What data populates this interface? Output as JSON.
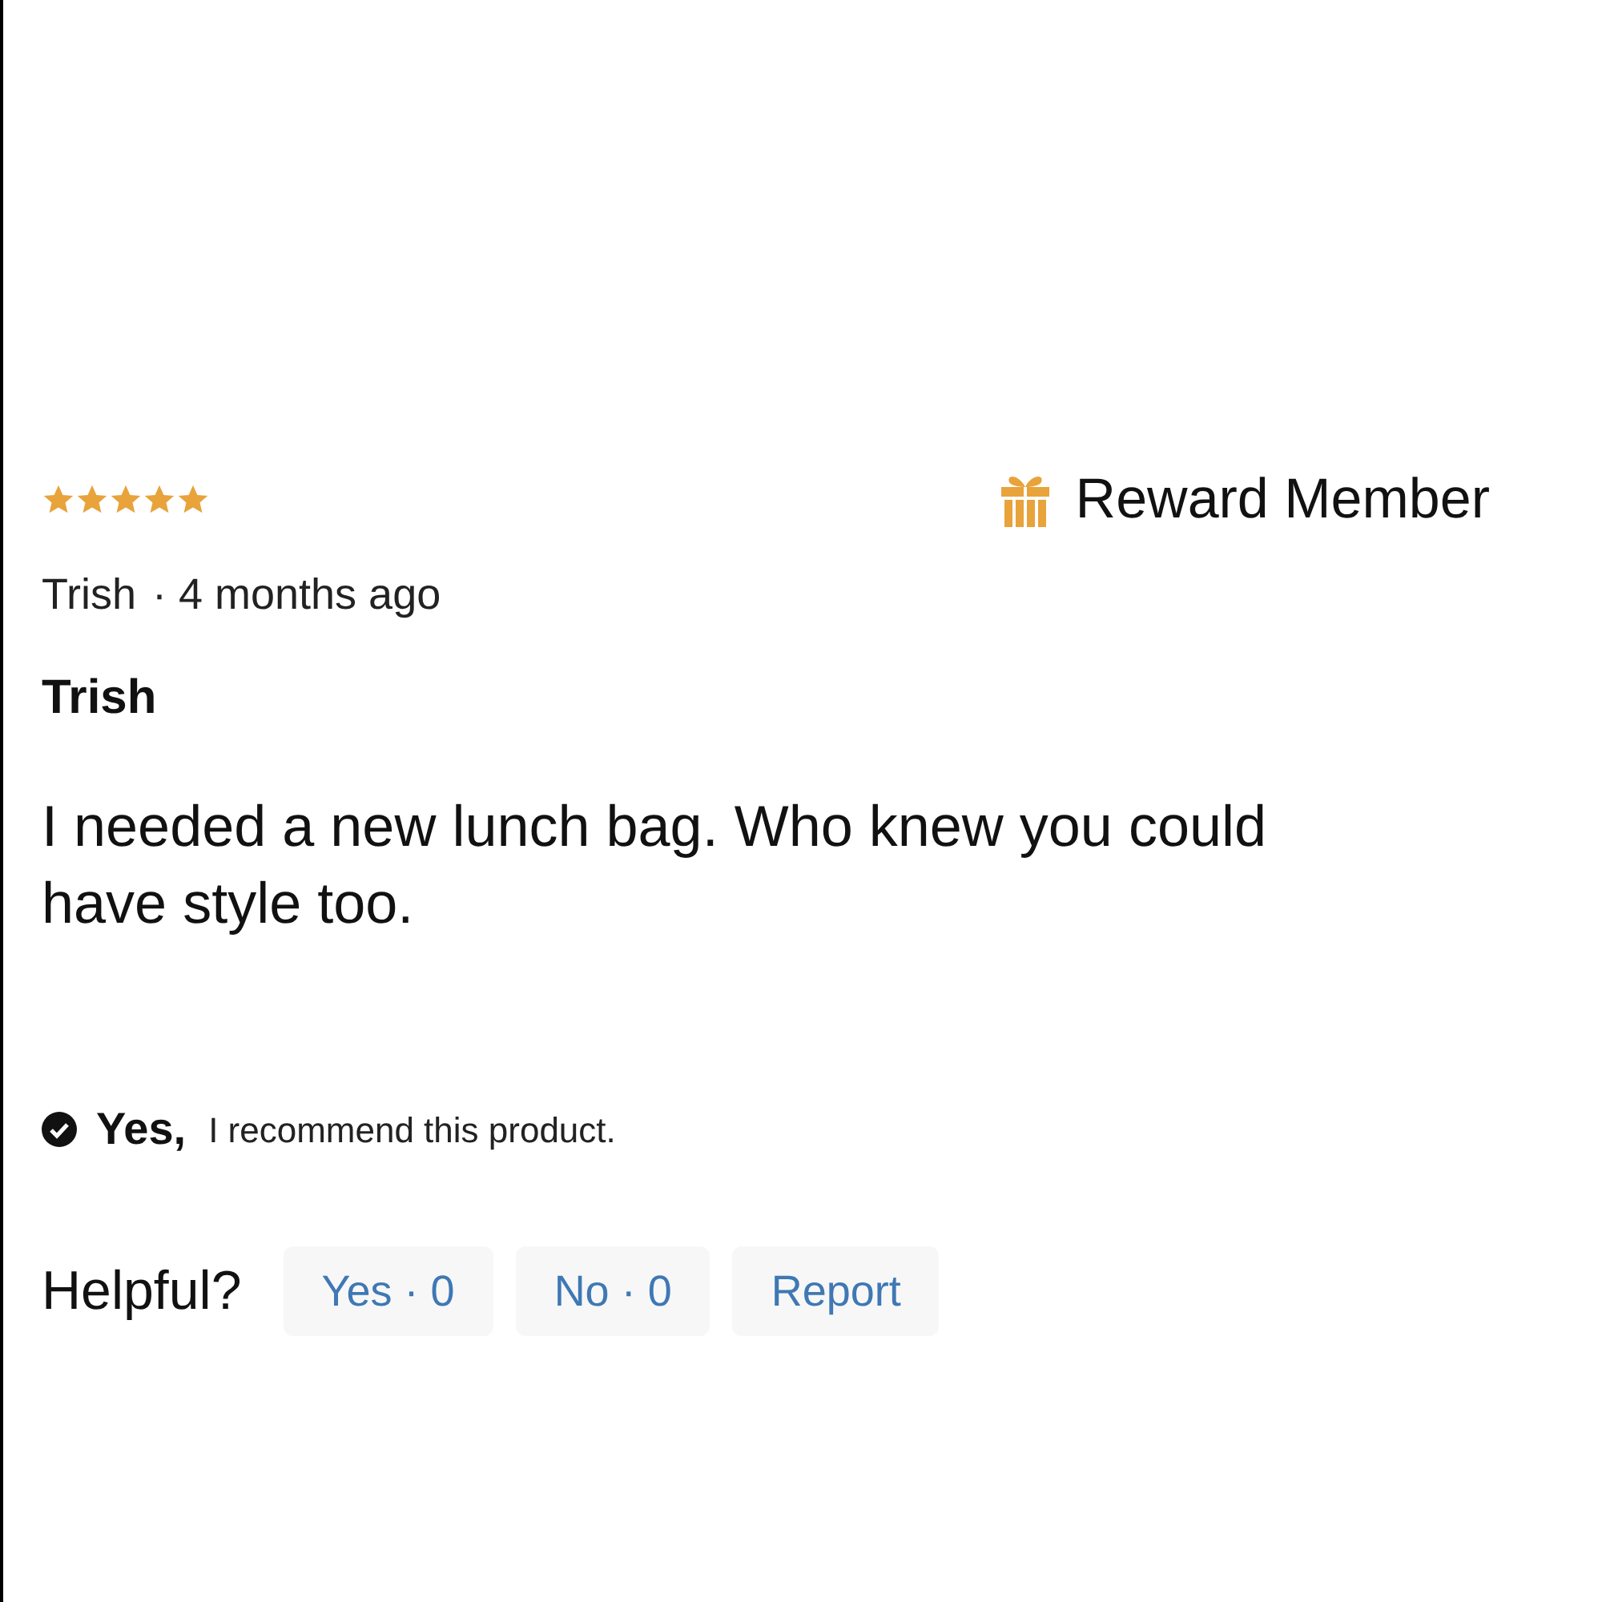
{
  "review": {
    "stars": 5,
    "badge": "Reward Member",
    "author": "Trish",
    "date": "· 4 months ago",
    "title": "Trish",
    "body": "I needed a new lunch bag. Who knew you could have style too.",
    "recommend": {
      "checked": true,
      "answer": "Yes,",
      "text": "I recommend this product."
    },
    "helpful": {
      "label": "Helpful?",
      "buttons": [
        "Yes · 0",
        "No · 0",
        "Report"
      ]
    }
  }
}
